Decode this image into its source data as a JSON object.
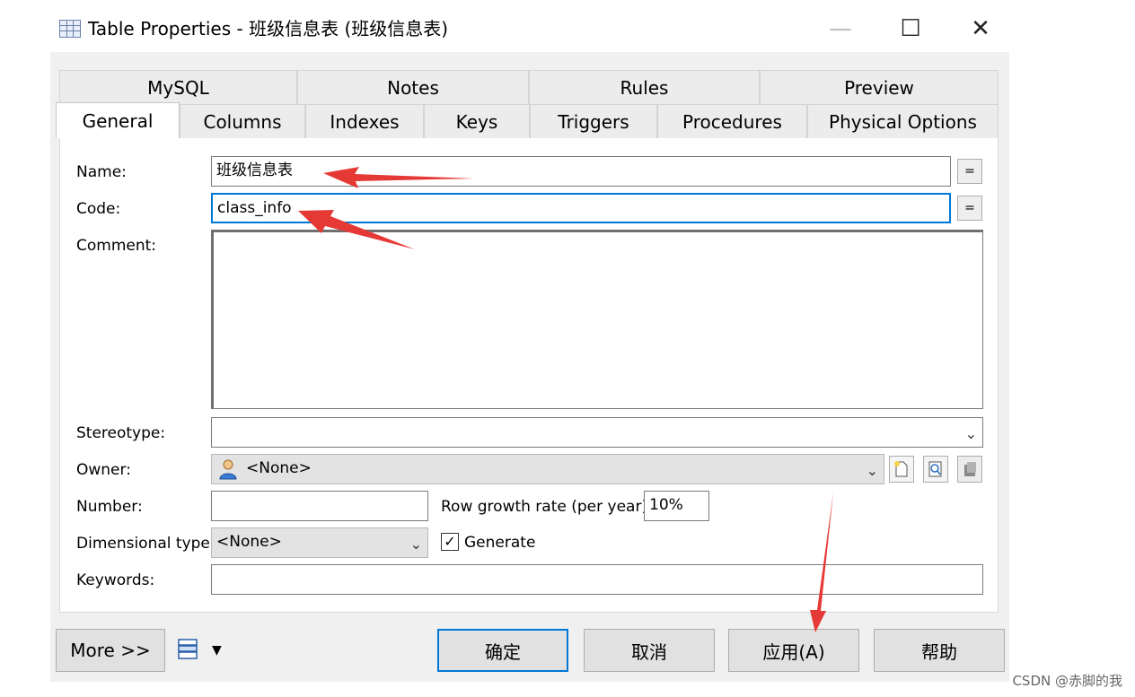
{
  "window": {
    "title": "Table Properties - 班级信息表 (班级信息表)",
    "controls": [
      "—",
      "☐",
      "✕"
    ]
  },
  "tabs": {
    "row1": [
      "MySQL",
      "Notes",
      "Rules",
      "Preview"
    ],
    "row2": [
      "General",
      "Columns",
      "Indexes",
      "Keys",
      "Triggers",
      "Procedures",
      "Physical Options"
    ],
    "active": "General"
  },
  "form": {
    "name_label": "Name:",
    "name_value": "班级信息表",
    "code_label": "Code:",
    "code_value": "class_info",
    "comment_label": "Comment:",
    "comment_value": "",
    "eq_button": "=",
    "stereotype_label": "Stereotype:",
    "stereotype_value": "",
    "owner_label": "Owner:",
    "owner_value": "<None>",
    "number_label": "Number:",
    "number_value": "",
    "row_growth_label": "Row growth rate (per year):",
    "row_growth_value": "10%",
    "dimensional_label": "Dimensional type:",
    "dimensional_value": "<None>",
    "generate_label": "Generate",
    "generate_checked": true,
    "keywords_label": "Keywords:",
    "keywords_value": ""
  },
  "footer": {
    "more": "More >>",
    "ok": "确定",
    "cancel": "取消",
    "apply": "应用(A)",
    "help": "帮助"
  },
  "annotations": {
    "arrow_color": "#e53935",
    "targets": [
      "name-field",
      "code-field",
      "apply-button"
    ]
  },
  "watermark": "CSDN @赤脚的我"
}
